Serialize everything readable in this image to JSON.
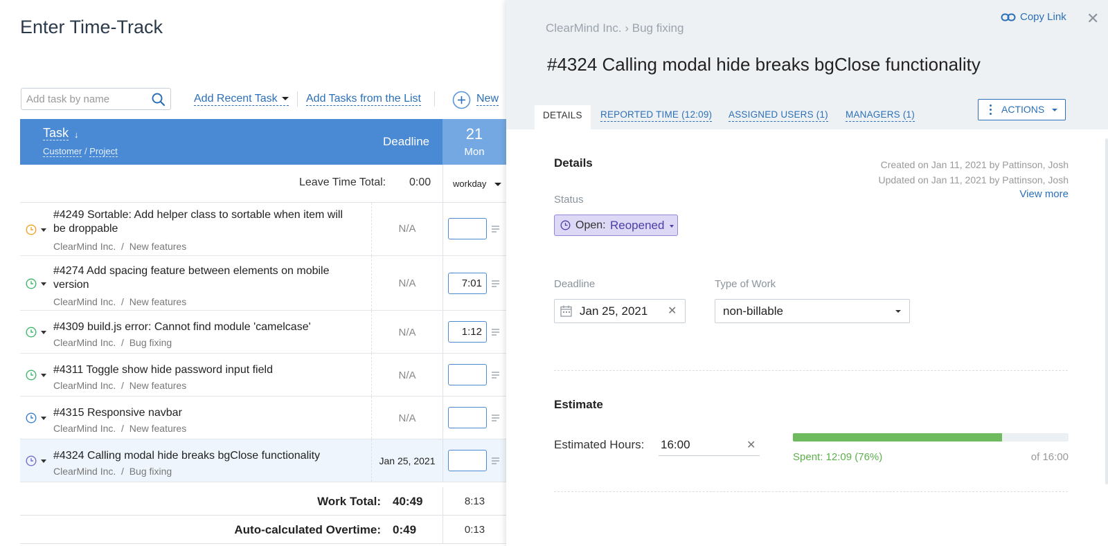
{
  "page": {
    "title": "Enter Time-Track"
  },
  "toolbar": {
    "search_placeholder": "Add task by name",
    "add_recent": "Add Recent Task",
    "add_from_list": "Add Tasks from the List",
    "new_label": "New"
  },
  "table": {
    "header": {
      "task": "Task",
      "customer": "Customer",
      "project": "Project",
      "sep": "/",
      "deadline": "Deadline",
      "day_num": "21",
      "day_name": "Mon"
    },
    "leave": {
      "label": "Leave Time Total:",
      "value": "0:00",
      "type": "workday"
    },
    "rows": [
      {
        "title": "#4249 Sortable: Add helper class to sortable when item will be droppable",
        "customer": "ClearMind Inc.",
        "project": "New features",
        "deadline": "N/A",
        "hours": "",
        "icon_color": "#f0a323"
      },
      {
        "title": "#4274 Add spacing feature between elements on mobile version",
        "customer": "ClearMind Inc.",
        "project": "New features",
        "deadline": "N/A",
        "hours": "7:01",
        "icon_color": "#3db86b"
      },
      {
        "title": "#4309 build.js error: Cannot find module 'camelcase'",
        "customer": "ClearMind Inc.",
        "project": "Bug fixing",
        "deadline": "N/A",
        "hours": "1:12",
        "icon_color": "#3db86b"
      },
      {
        "title": "#4311 Toggle show hide password input field",
        "customer": "ClearMind Inc.",
        "project": "New features",
        "deadline": "N/A",
        "hours": "",
        "icon_color": "#3db86b"
      },
      {
        "title": "#4315 Responsive navbar",
        "customer": "ClearMind Inc.",
        "project": "New features",
        "deadline": "N/A",
        "hours": "",
        "icon_color": "#3a7fd1"
      },
      {
        "title": "#4324 Calling modal hide breaks bgClose functionality",
        "customer": "ClearMind Inc.",
        "project": "Bug fixing",
        "deadline": "Jan 25, 2021",
        "hours": "",
        "icon_color": "#7a6ccf"
      }
    ],
    "work_total": {
      "label": "Work Total:",
      "value": "40:49",
      "day": "8:13"
    },
    "overtime": {
      "label": "Auto-calculated Overtime:",
      "value": "0:49",
      "day": "0:13"
    }
  },
  "detail": {
    "breadcrumb": {
      "customer": "ClearMind Inc.",
      "sep": "›",
      "project": "Bug fixing"
    },
    "copy_link": "Copy Link",
    "title": "#4324 Calling modal hide breaks bgClose functionality",
    "tabs": [
      "DETAILS",
      "REPORTED TIME (12:09)",
      "ASSIGNED USERS (1)",
      "MANAGERS (1)"
    ],
    "actions_label": "ACTIONS",
    "details": {
      "heading": "Details",
      "created": "Created on Jan 11, 2021 by Pattinson, Josh",
      "updated": "Updated on Jan 11, 2021 by Pattinson, Josh",
      "view_more": "View more",
      "status_label": "Status",
      "status_open": "Open:",
      "status_value": "Reopened",
      "deadline_label": "Deadline",
      "deadline_value": "Jan 25, 2021",
      "type_label": "Type of Work",
      "type_value": "non-billable"
    },
    "estimate": {
      "heading": "Estimate",
      "label": "Estimated Hours:",
      "value": "16:00",
      "spent_text": "Spent: 12:09 (76%)",
      "total_text": "of 16:00",
      "progress_percent": 76
    }
  },
  "colors": {
    "accent": "#2a6fb8",
    "header_blue": "#4a8ad4",
    "status_purple": "#dcd8f6",
    "progress_green": "#6fba5e"
  }
}
